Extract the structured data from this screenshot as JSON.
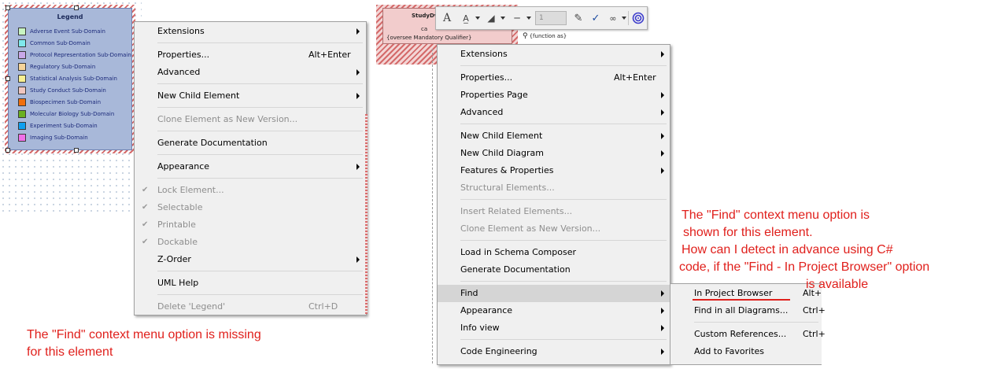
{
  "legend": {
    "title": "Legend",
    "items": [
      {
        "label": "Adverse Event Sub-Domain",
        "color": "#c8f5c2"
      },
      {
        "label": "Common Sub-Domain",
        "color": "#7fe9ec"
      },
      {
        "label": "Protocol Representation Sub-Domain",
        "color": "#c8a8e8"
      },
      {
        "label": "Regulatory Sub-Domain",
        "color": "#f5d49a"
      },
      {
        "label": "Statistical Analysis Sub-Domain",
        "color": "#f7ef92"
      },
      {
        "label": "Study Conduct Sub-Domain",
        "color": "#f0c6c0"
      },
      {
        "label": "Biospecimen Sub-Domain",
        "color": "#f07010"
      },
      {
        "label": "Molecular Biology Sub-Domain",
        "color": "#6ab020"
      },
      {
        "label": "Experiment Sub-Domain",
        "color": "#10a0f0"
      },
      {
        "label": "Imaging Sub-Domain",
        "color": "#f070e8"
      }
    ]
  },
  "left_menu": {
    "items": [
      {
        "label": "Extensions",
        "submenu": true
      },
      {
        "label": "Properties...",
        "shortcut": "Alt+Enter"
      },
      {
        "label": "Advanced",
        "submenu": true
      },
      {
        "label": "New Child Element",
        "submenu": true
      },
      {
        "label": "Clone Element as New Version...",
        "disabled": true
      },
      {
        "label": "Generate Documentation"
      },
      {
        "label": "Appearance",
        "submenu": true
      },
      {
        "label": "Lock Element...",
        "disabled": true,
        "checked": true
      },
      {
        "label": "Selectable",
        "disabled": true,
        "checked": true
      },
      {
        "label": "Printable",
        "disabled": true,
        "checked": true
      },
      {
        "label": "Dockable",
        "disabled": true,
        "checked": true
      },
      {
        "label": "Z-Order",
        "submenu": true
      },
      {
        "label": "UML Help"
      },
      {
        "label": "Delete 'Legend'",
        "shortcut": "Ctrl+D",
        "disabled": true
      }
    ]
  },
  "right_menu": {
    "items": [
      {
        "label": "Extensions",
        "submenu": true
      },
      {
        "label": "Properties...",
        "shortcut": "Alt+Enter"
      },
      {
        "label": "Properties Page",
        "submenu": true
      },
      {
        "label": "Advanced",
        "submenu": true
      },
      {
        "label": "New Child Element",
        "submenu": true
      },
      {
        "label": "New Child Diagram",
        "submenu": true
      },
      {
        "label": "Features & Properties",
        "submenu": true
      },
      {
        "label": "Structural Elements...",
        "disabled": true
      },
      {
        "label": "Insert Related Elements...",
        "disabled": true
      },
      {
        "label": "Clone Element as New Version...",
        "disabled": true
      },
      {
        "label": "Load in Schema Composer"
      },
      {
        "label": "Generate Documentation"
      },
      {
        "label": "Find",
        "submenu": true,
        "highlighted": true
      },
      {
        "label": "Appearance",
        "submenu": true
      },
      {
        "label": "Info view",
        "submenu": true
      },
      {
        "label": "Code Engineering",
        "submenu": true
      }
    ]
  },
  "find_submenu": {
    "items": [
      {
        "label": "In Project Browser",
        "shortcut": "Alt+"
      },
      {
        "label": "Find in all Diagrams...",
        "shortcut": "Ctrl+"
      },
      {
        "label": "Custom References...",
        "shortcut": "Ctrl+"
      },
      {
        "label": "Add to Favorites",
        "shortcut": ""
      }
    ]
  },
  "element": {
    "name": "StudyDv",
    "stereotype_line": "ca",
    "constraint": "{oversee Mandatory Qualifier}",
    "function_label": "{function as}"
  },
  "toolbar": {
    "line_width_value": "1"
  },
  "annotations": {
    "missing_line1": "The \"Find\" context menu option is missing",
    "missing_line2": "for this element",
    "shown_line1": "The \"Find\" context menu option is",
    "shown_line2": "shown for this element.",
    "shown_line3": "How can I detect in advance using C#",
    "shown_line4": "code, if the \"Find - In Project Browser\" option",
    "shown_line5": "is available"
  },
  "colors": {
    "annotation": "#e0201c",
    "element_fill": "#f2cccc",
    "legend_fill": "#a8b8d9"
  }
}
